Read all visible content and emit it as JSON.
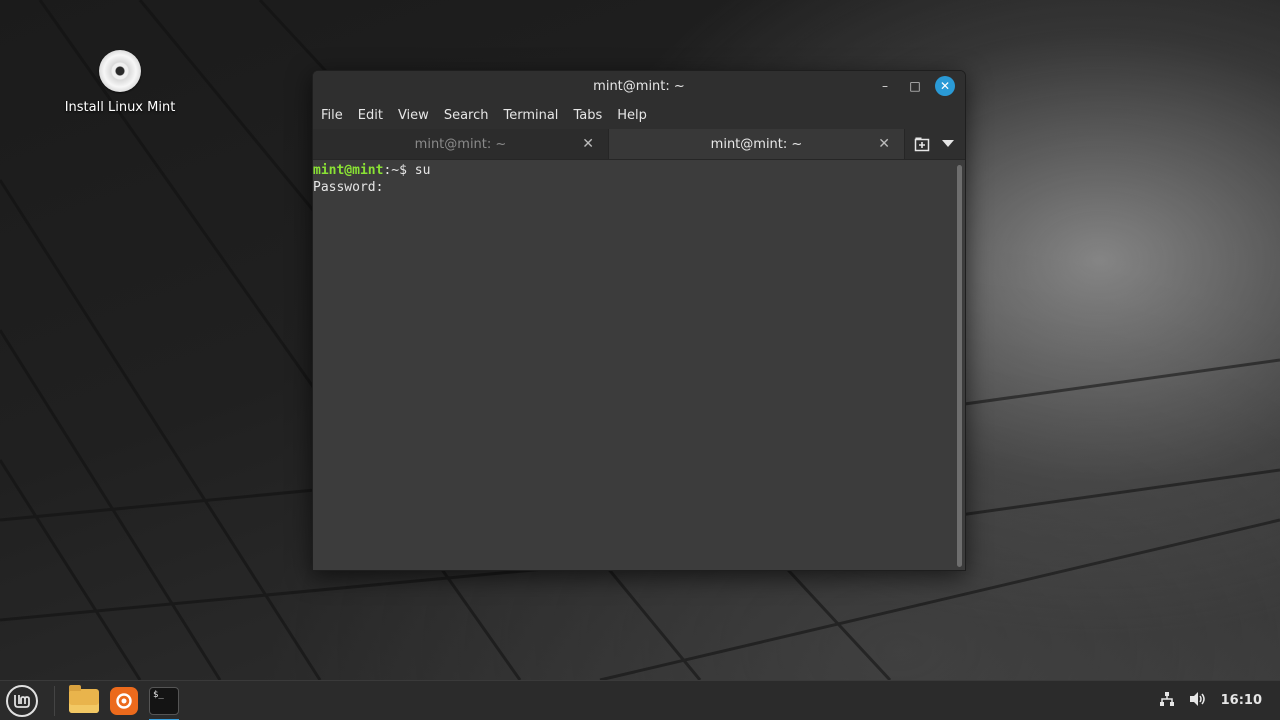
{
  "desktop": {
    "icons": [
      {
        "label": "Install Linux Mint",
        "icon": "disc-icon"
      }
    ]
  },
  "window": {
    "title": "mint@mint: ~",
    "controls": {
      "minimize": "–",
      "maximize": "□",
      "close": "✕"
    },
    "menu": [
      "File",
      "Edit",
      "View",
      "Search",
      "Terminal",
      "Tabs",
      "Help"
    ],
    "tabs": [
      {
        "label": "mint@mint: ~",
        "active": false,
        "close": "✕"
      },
      {
        "label": "mint@mint: ~",
        "active": true,
        "close": "✕"
      }
    ],
    "tab_tools": {
      "new_tab": "new-tab-icon",
      "dropdown": "chevron-down-icon"
    },
    "terminal": {
      "prompt_user": "mint@mint",
      "prompt_path": ":~$",
      "command": " su",
      "output": "Password:"
    }
  },
  "taskbar": {
    "menu_icon": "mint-menu-icon",
    "launchers": [
      {
        "name": "files",
        "icon": "folder-icon"
      },
      {
        "name": "firefox",
        "icon": "firefox-icon"
      },
      {
        "name": "terminal",
        "icon": "terminal-icon",
        "active": true,
        "glyph": "$_"
      }
    ],
    "tray": {
      "network": "network-icon",
      "volume": "volume-icon",
      "clock": "16:10"
    }
  },
  "colors": {
    "accent": "#35a0e0",
    "prompt": "#8ae234",
    "close_button": "#2a9ad6"
  }
}
